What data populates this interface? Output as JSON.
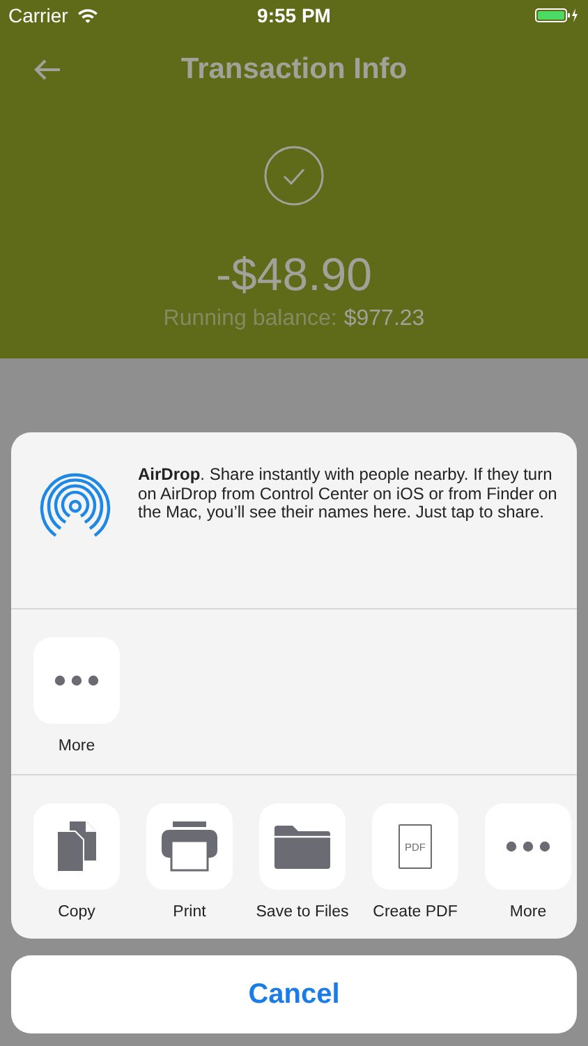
{
  "status_bar": {
    "carrier": "Carrier",
    "time": "9:55 PM"
  },
  "header": {
    "title": "Transaction Info",
    "amount": "-$48.90",
    "balance_label": "Running balance:",
    "balance_value": "$977.23"
  },
  "share_sheet": {
    "airdrop_text": "**AirDrop**. Share instantly with people nearby. If they turn on AirDrop from Control Center on iOS or from Finder on the Mac, you’ll see their names here. Just tap to share.",
    "apps": [
      {
        "kind": "more",
        "label": "More"
      }
    ],
    "actions": [
      {
        "kind": "copy",
        "label": "Copy"
      },
      {
        "kind": "print",
        "label": "Print"
      },
      {
        "kind": "files",
        "label": "Save to Files"
      },
      {
        "kind": "pdf",
        "label": "Create PDF",
        "icon_text": "PDF"
      },
      {
        "kind": "more",
        "label": "More"
      }
    ],
    "cancel": "Cancel"
  }
}
